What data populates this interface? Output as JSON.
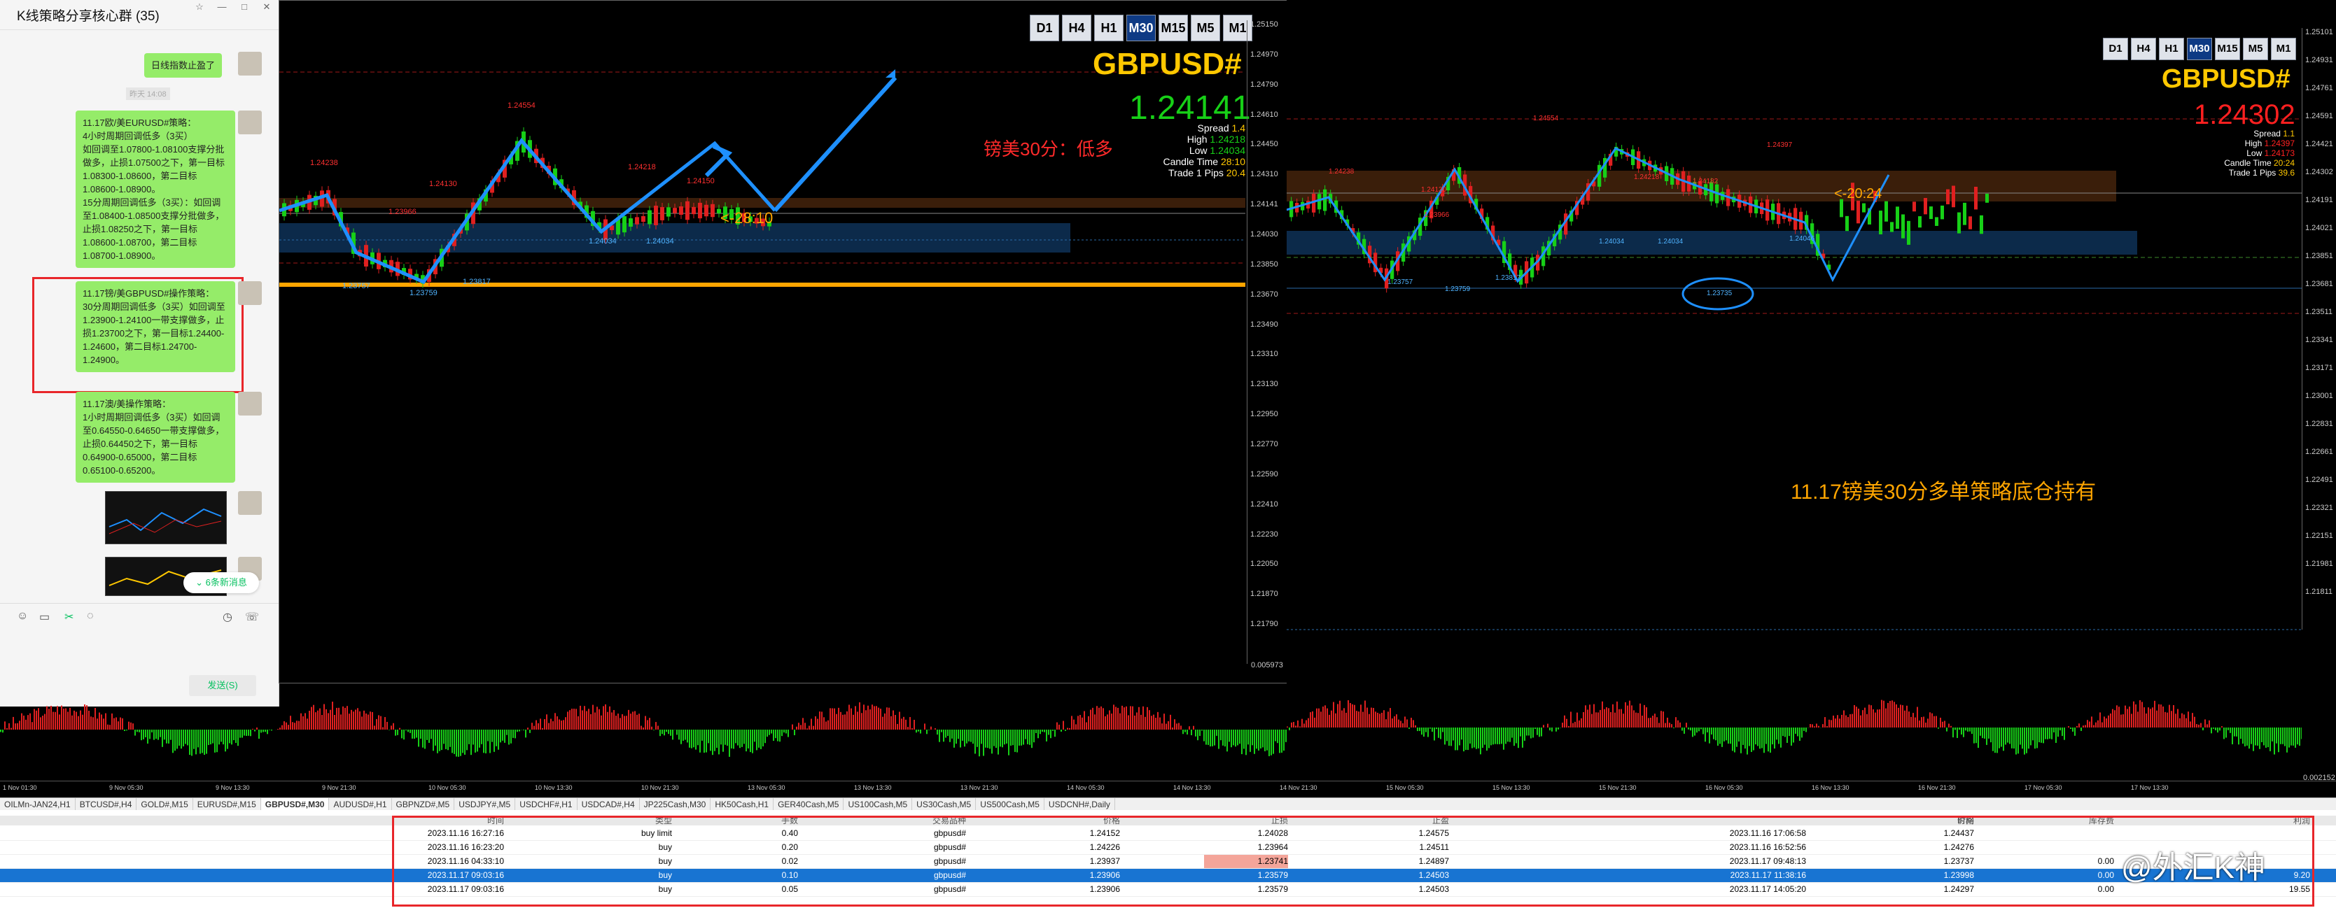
{
  "chat": {
    "title": "K线策略分享核心群 (35)",
    "win_buttons": [
      "☆",
      "—",
      "□",
      "✕"
    ],
    "messages": [
      "日线指数止盈了",
      "11.17欧/美EURUSD#策略：\n4小时周期回调低多（3买）\n如回调至1.07800-1.08100支撑分批做多，止损1.07500之下，第一目标1.08300-1.08600，第二目标1.08600-1.08900。\n15分周期回调低多（3买）：如回调至1.08400-1.08500支撑分批做多，止损1.08250之下，第一目标1.08600-1.08700，第二目标1.08700-1.08900。",
      "11.17镑/美GBPUSD#操作策略：\n30分周期回调低多（3买）如回调至1.23900-1.24100一带支撑做多，止损1.23700之下，第一目标1.24400-1.24600，第二目标1.24700-1.24900。",
      "11.17澳/美操作策略：\n1小时周期回调低多（3买）如回调至0.64550-0.64650一带支撑做多，止损0.64450之下，第一目标0.64900-0.65000，第二目标0.65100-0.65200。"
    ],
    "time_label": "昨天 14:08",
    "new_messages": "⌄ 6条新消息",
    "send_label": "发送(S)",
    "toolbar_icons": [
      "smile-icon",
      "folder-icon",
      "scissors-icon",
      "chat-icon",
      "clock-icon",
      "phone-icon"
    ]
  },
  "left_chart": {
    "timeframes": [
      "D1",
      "H4",
      "H1",
      "M30",
      "M15",
      "M5",
      "M1"
    ],
    "active_tf": "M30",
    "symbol": "GBPUSD#",
    "price": "1.24141",
    "info": [
      [
        "Spread",
        "1.4"
      ],
      [
        "High",
        "1.24218"
      ],
      [
        "Low",
        "1.24034"
      ],
      [
        "Candle Time",
        "28:10"
      ],
      [
        "Trade 1 Pips",
        "20.4"
      ]
    ],
    "annotation": "镑美30分：低多",
    "countdown": "<-28:10",
    "price_labels": [
      "1.24554",
      "1.24238",
      "1.24130",
      "1.24218",
      "1.24150",
      "1.23966",
      "1.24034",
      "1.24034",
      "1.23757",
      "1.23759",
      "1.23817"
    ],
    "scale": [
      "1.25150",
      "1.24970",
      "1.24790",
      "1.24610",
      "1.24450",
      "1.24310",
      "1.24141",
      "1.24030",
      "1.23850",
      "1.23670",
      "1.23490",
      "1.23310",
      "1.23130",
      "1.22950",
      "1.22770",
      "1.22590",
      "1.22410",
      "1.22230",
      "1.22050",
      "1.21870",
      "1.21790"
    ],
    "scale_last": "0.005973"
  },
  "right_chart": {
    "timeframes": [
      "D1",
      "H4",
      "H1",
      "M30",
      "M15",
      "M5",
      "M1"
    ],
    "active_tf": "M30",
    "symbol": "GBPUSD#",
    "price": "1.24302",
    "info": [
      [
        "Spread",
        "1.1"
      ],
      [
        "High",
        "1.24397"
      ],
      [
        "Low",
        "1.24173"
      ],
      [
        "Candle Time",
        "20:24"
      ],
      [
        "Trade 1 Pips",
        "39.6"
      ]
    ],
    "annotation": "11.17镑美30分多单策略底仓持有",
    "countdown": "<-20:24",
    "price_labels": [
      "1.24554",
      "1.24238",
      "1.24130",
      "1.24218",
      "1.24182",
      "1.24397",
      "1.23966",
      "1.24034",
      "1.24034",
      "1.24046",
      "1.23757",
      "1.23759",
      "1.23817",
      "1.23735"
    ],
    "scale": [
      "1.25101",
      "1.24931",
      "1.24761",
      "1.24591",
      "1.24421",
      "1.24302",
      "1.24191",
      "1.24021",
      "1.23851",
      "1.23681",
      "1.23511",
      "1.23341",
      "1.23171",
      "1.23001",
      "1.22831",
      "1.22661",
      "1.22491",
      "1.22321",
      "1.22151",
      "1.21981",
      "1.21811"
    ],
    "scale_last": "0.002152"
  },
  "time_axis": [
    "1 Nov 01:30",
    "9 Nov 05:30",
    "9 Nov 13:30",
    "9 Nov 21:30",
    "10 Nov 05:30",
    "10 Nov 13:30",
    "10 Nov 21:30",
    "13 Nov 05:30",
    "13 Nov 13:30",
    "13 Nov 21:30",
    "14 Nov 05:30",
    "14 Nov 13:30",
    "14 Nov 21:30",
    "15 Nov 05:30",
    "15 Nov 13:30",
    "15 Nov 21:30",
    "16 Nov 05:30",
    "16 Nov 13:30",
    "16 Nov 21:30",
    "17 Nov 05:30",
    "17 Nov 13:30"
  ],
  "symbol_tabs": [
    "OILMn-JAN24,H1",
    "BTCUSD#,H4",
    "GOLD#,M15",
    "EURUSD#,M15",
    "GBPUSD#,M30",
    "AUDUSD#,H1",
    "GBPNZD#,M5",
    "USDJPY#,M5",
    "USDCHF#,H1",
    "USDCAD#,H4",
    "JP225Cash,M30",
    "HK50Cash,H1",
    "GER40Cash,M5",
    "US100Cash,M5",
    "US30Cash,M5",
    "US500Cash,M5",
    "USDCNH#,Daily"
  ],
  "active_tab": "GBPUSD#,M30",
  "trades": {
    "headers": [
      "时间",
      "类型",
      "手数",
      "交易品种",
      "价格",
      "止损",
      "止盈",
      "时间",
      "价格",
      "库存费",
      "利润"
    ],
    "rows": [
      [
        "2023.11.16 16:27:16",
        "buy limit",
        "0.40",
        "gbpusd#",
        "1.24152",
        "1.24028",
        "1.24575",
        "2023.11.16 17:06:58",
        "1.24437",
        "",
        ""
      ],
      [
        "2023.11.16 16:23:20",
        "buy",
        "0.20",
        "gbpusd#",
        "1.24226",
        "1.23964",
        "1.24511",
        "2023.11.16 16:52:56",
        "1.24276",
        "",
        ""
      ],
      [
        "2023.11.16 04:33:10",
        "buy",
        "0.02",
        "gbpusd#",
        "1.23937",
        "1.23741",
        "1.24897",
        "2023.11.17 09:48:13",
        "1.23737",
        "0.00",
        ""
      ],
      [
        "2023.11.17 09:03:16",
        "buy",
        "0.10",
        "gbpusd#",
        "1.23906",
        "1.23579",
        "1.24503",
        "2023.11.17 11:38:16",
        "1.23998",
        "0.00",
        "9.20"
      ],
      [
        "2023.11.17 09:03:16",
        "buy",
        "0.05",
        "gbpusd#",
        "1.23906",
        "1.23579",
        "1.24503",
        "2023.11.17 14:05:20",
        "1.24297",
        "0.00",
        "19.55"
      ]
    ],
    "selected_row": 3,
    "highlight_cell": [
      2,
      5
    ]
  },
  "watermark": "@外汇K神",
  "colors": {
    "bull": "#17d017",
    "bear": "#e02020",
    "ma_blue": "#1e90ff",
    "gold": "#ffc800",
    "zone_orange": "#5a3210",
    "zone_blue": "#0c2a4a"
  }
}
